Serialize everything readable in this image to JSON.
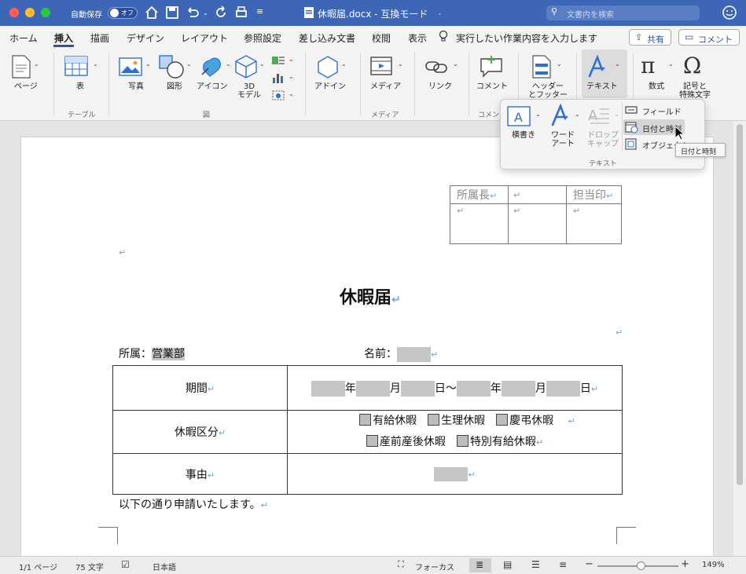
{
  "titlebar": {
    "autosave_label": "自動保存",
    "autosave_state": "オフ",
    "doc_title": "休暇届.docx  -  互換モード",
    "search_placeholder": "文書内を検索"
  },
  "tabs": [
    "ホーム",
    "挿入",
    "描画",
    "デザイン",
    "レイアウト",
    "参照設定",
    "差し込み文書",
    "校閲",
    "表示"
  ],
  "tell_me": "実行したい作業内容を入力します",
  "share_label": "共有",
  "comment_label": "コメント",
  "ribbon": {
    "page": "ページ",
    "table": "表",
    "table_group": "テーブル",
    "photo": "写真",
    "shape": "図形",
    "icon": "アイコン",
    "model3d": "3D\nモデル",
    "fig_group": "図",
    "addin": "アドイン",
    "media": "メディア",
    "media_group": "メディア",
    "link": "リンク",
    "comment": "コメント",
    "comment_group": "コメン",
    "header_footer": "ヘッダー\nとフッター",
    "text": "テキスト",
    "equation": "数式",
    "symbol": "記号と\n特殊文字"
  },
  "text_popup": {
    "textbox": "横書き",
    "wordart": "ワード\nアート",
    "dropcap": "ドロップ\nキャップ",
    "field": "フィールド",
    "datetime": "日付と時刻",
    "object": "オブジェクト",
    "group_label": "テキスト",
    "tooltip": "日付と時刻"
  },
  "doc": {
    "stamp_headers": [
      "所属長",
      "",
      "担当印"
    ],
    "title": "休暇届",
    "dept_label": "所属：",
    "dept_value": "営業部",
    "name_label": "名前：",
    "period_label": "期間",
    "year": "年",
    "month": "月",
    "day": "日",
    "tilde": "〜",
    "category_label": "休暇区分",
    "options": [
      "有給休暇",
      "生理休暇",
      "慶弔休暇",
      "産前産後休暇",
      "特別有給休暇"
    ],
    "reason_label": "事由",
    "closing": "以下の通り申請いたします。"
  },
  "status": {
    "page": "1/1 ページ",
    "words": "75 文字",
    "lang": "日本語",
    "focus": "フォーカス",
    "zoom": "149%"
  },
  "colors": {
    "titlebar": "#3d66b7",
    "accent": "#2f5597",
    "icon_blue": "#2f6fd0"
  }
}
